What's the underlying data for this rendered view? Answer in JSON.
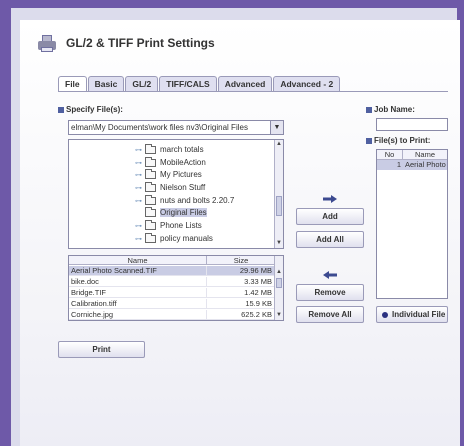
{
  "window": {
    "title": "GL/2 & TIFF Print Settings",
    "logo": "printer-logo"
  },
  "tabs": [
    {
      "label": "File",
      "active": true
    },
    {
      "label": "Basic",
      "active": false
    },
    {
      "label": "GL/2",
      "active": false
    },
    {
      "label": "TIFF/CALS",
      "active": false
    },
    {
      "label": "Advanced",
      "active": false
    },
    {
      "label": "Advanced - 2",
      "active": false
    }
  ],
  "left": {
    "specify_label": "Specify File(s):",
    "path_value": "elman\\My Documents\\work files nv3\\Original Files",
    "tree": [
      {
        "label": "march totals",
        "selected": false
      },
      {
        "label": "MobileAction",
        "selected": false
      },
      {
        "label": "My Pictures",
        "selected": false
      },
      {
        "label": "Nielson Stuff",
        "selected": false
      },
      {
        "label": "nuts and bolts 2.20.7",
        "selected": false
      },
      {
        "label": "Original Files",
        "selected": true
      },
      {
        "label": "Phone Lists",
        "selected": false
      },
      {
        "label": "policy manuals",
        "selected": false
      }
    ],
    "file_table": {
      "headers": [
        "Name",
        "Size"
      ],
      "rows": [
        {
          "name": "Aerial Photo Scanned.TIF",
          "size": "29.96 MB",
          "selected": true
        },
        {
          "name": "bike.doc",
          "size": "3.33 MB",
          "selected": false
        },
        {
          "name": "Bridge.TIF",
          "size": "1.42 MB",
          "selected": false
        },
        {
          "name": "Calibration.tiff",
          "size": "15.9 KB",
          "selected": false
        },
        {
          "name": "Corniche.jpg",
          "size": "625.2 KB",
          "selected": false
        }
      ]
    }
  },
  "middle": {
    "add": "Add",
    "add_all": "Add All",
    "remove": "Remove",
    "remove_all": "Remove All",
    "right_arrow_icon": "arrow-right-icon",
    "left_arrow_icon": "arrow-left-icon"
  },
  "right": {
    "job_name_label": "Job Name:",
    "files_to_print_label": "File(s) to Print:",
    "print_table_headers": [
      "No",
      "Name"
    ],
    "print_rows": [
      {
        "no": "1",
        "name": "Aerial Photo"
      }
    ],
    "individual_label": "Individual File S"
  },
  "footer": {
    "print": "Print"
  },
  "colors": {
    "border": "#6e59a8",
    "selection": "#c9cce4",
    "section_marker": "#5060a0"
  }
}
